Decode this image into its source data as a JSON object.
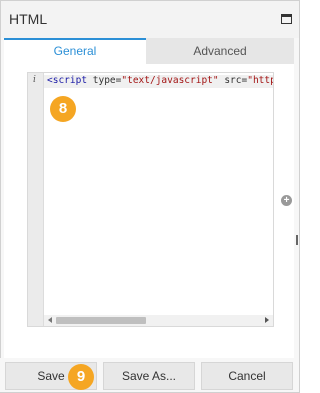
{
  "dialog": {
    "title": "HTML"
  },
  "tabs": [
    {
      "label": "General",
      "active": true
    },
    {
      "label": "Advanced",
      "active": false
    }
  ],
  "editor": {
    "gutter_marker": "i",
    "code_tag": "<script",
    "code_attr1": " type=",
    "code_str1": "\"text/javascript\"",
    "code_attr2": " src=",
    "code_str2": "\"https://"
  },
  "badges": {
    "editor_step": "8",
    "save_step": "9"
  },
  "footer": {
    "save_label": "Save",
    "save_as_label": "Save As...",
    "cancel_label": "Cancel"
  },
  "colors": {
    "accent": "#2b8fd6",
    "badge": "#f5a623"
  }
}
